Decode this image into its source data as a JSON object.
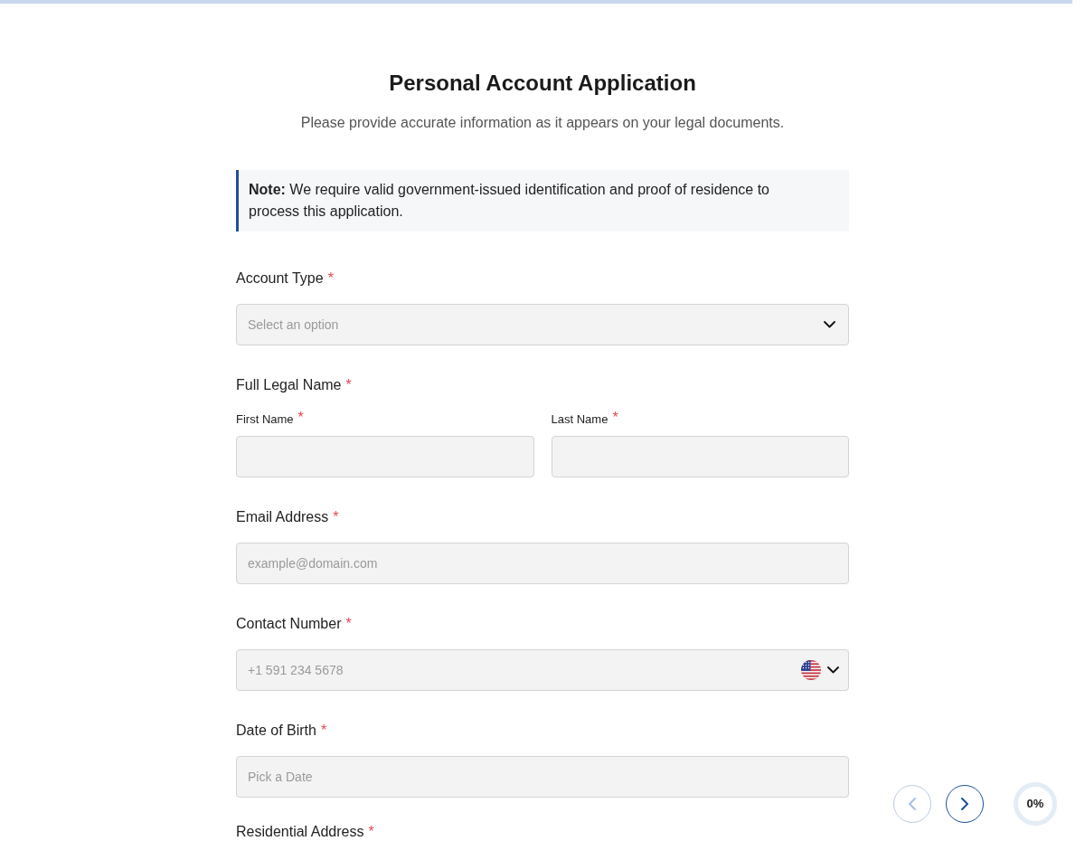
{
  "top_progress": {
    "level": 0
  },
  "header": {
    "title": "Personal Account Application",
    "subtitle": "Please provide accurate information as it appears on your legal documents."
  },
  "note": {
    "text": "**Note:** We require valid government-issued identification and proof of residence to process this application."
  },
  "fields": [
    {
      "kind": "select",
      "label": "Account Type",
      "required_mark": "*",
      "placeholder": "Select an option"
    },
    {
      "kind": "name_pair",
      "label": "Full Legal Name",
      "required_mark": "*",
      "parts": [
        {
          "label": "First Name",
          "required_mark": "*"
        },
        {
          "label": "Last Name",
          "required_mark": "*"
        }
      ]
    },
    {
      "kind": "text",
      "label": "Email Address",
      "required_mark": "*",
      "placeholder": "example@domain.com"
    },
    {
      "kind": "phone",
      "label": "Contact Number",
      "required_mark": "*",
      "placeholder": "+1 591 234 5678"
    },
    {
      "kind": "date",
      "label": "Date of Birth",
      "required_mark": "*",
      "placeholder": "Pick a Date"
    },
    {
      "kind": "address",
      "label": "Residential Address",
      "required_mark": "*"
    }
  ],
  "nav": {
    "buttons": [
      {
        "kind": "previous",
        "disabled": true
      },
      {
        "kind": "next",
        "disabled": false
      }
    ]
  },
  "progress": {
    "label": "0%"
  }
}
